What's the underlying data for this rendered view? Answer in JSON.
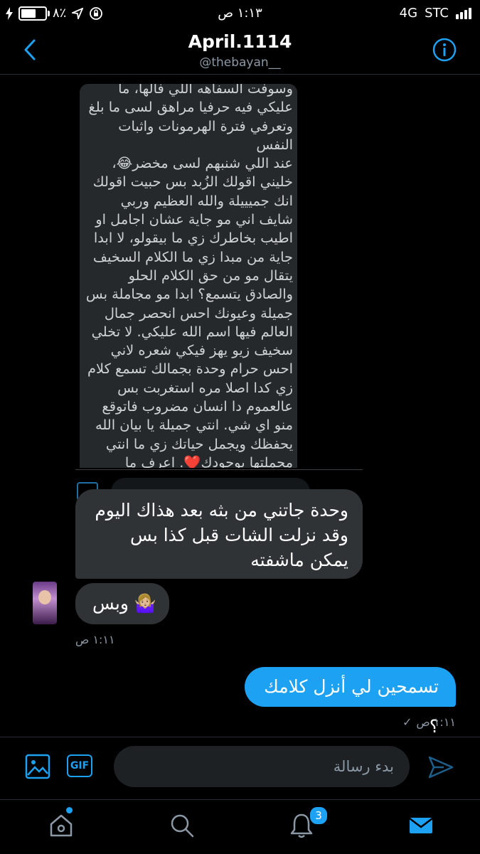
{
  "status_bar": {
    "battery_percent": "٨٪",
    "time": "١:١٣ ص",
    "network": "4G",
    "carrier": "STC"
  },
  "header": {
    "title": "April.1114",
    "handle": "@thebayan__"
  },
  "screenshot_text": "وسوفت السفاهه اللي فالها، ما\nعليكي فيه حرفيا مراهق لسى ما بلغ\nوتعرفي فترة الهرمونات واثبات النفس\nعند اللي شنبهم لسى مخضر😂،\nخليني اقولك الزُبد بس حبيت اقولك\nانك جميييلة والله العظيم وربي\nشايف اني مو جاية عشان اجامل او\nاطيب بخاطرك زي ما بيقولو، لا ابدا\nجاية من مبدا زي ما الكلام السخيف\nيتقال مو من حق الكلام الحلو\nوالصادق يتسمع؟ ابدا مو مجاملة بس\nجميلة وعيونك احس انحصر جمال\nالعالم فيها اسم الله عليكي. لا تخلي\nسخيف زيو يهز فيكي شعره لاني\nاحس حرام وحدة بجمالك تسمع كلام\nزي كدا اصلا مره استغربت بس\nعالعموم دا انسان مضروب فاتوقع\nمنو اي شي. انتي جميلة يا بيان الله\nيحفظك ويجمل حياتك زي ما انتي\nمجملتها بوجودك❤️.  اعرف ما\nتحتاجي كلام من انسان غريب بس\nالعدل شي واجب على كل شخص.\nيارب يومك سعيد وحياتك اسعد❤️",
  "messages": {
    "received_1": "وحدة جاتني من بثه بعد هذاك اليوم وقد نزلت الشات قبل كذا بس يمكن ماشفته",
    "received_2": "🤷🏼‍♀️ وبس",
    "received_time": "١:١١ ص",
    "sent_1": "تسمحين لي أنزل كلامك ؟",
    "sent_time": "١:١١ ص",
    "sent_check": "✓"
  },
  "composer": {
    "placeholder": "بدء رسالة",
    "gif_label": "GIF"
  },
  "tabbar": {
    "notifications_badge": "3"
  },
  "colors": {
    "accent": "#1da1f2",
    "background": "#000000",
    "bubble_grey": "#2f3336",
    "muted_text": "#8b98a5"
  }
}
